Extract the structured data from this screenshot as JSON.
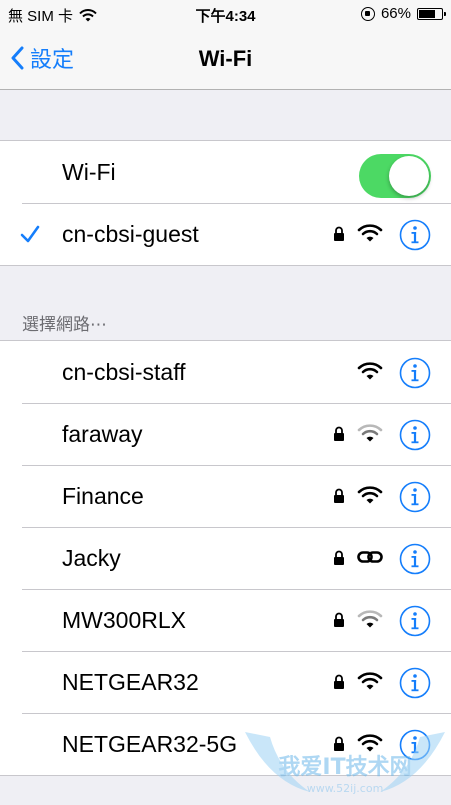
{
  "status_bar": {
    "carrier": "無 SIM 卡",
    "time": "下午4:34",
    "battery": "66%",
    "battery_level": 0.66
  },
  "nav": {
    "back_label": "設定",
    "title": "Wi-Fi"
  },
  "wifi_toggle": {
    "label": "Wi-Fi",
    "on": true,
    "color": "#4cd964"
  },
  "connected": {
    "name": "cn-cbsi-guest",
    "secured": true
  },
  "section_header": "選擇網路⋯",
  "networks": [
    {
      "name": "cn-cbsi-staff",
      "secured": false,
      "icon": "wifi-icon"
    },
    {
      "name": "faraway",
      "secured": true,
      "icon": "wifi-icon-weak"
    },
    {
      "name": "Finance",
      "secured": true,
      "icon": "wifi-icon"
    },
    {
      "name": "Jacky",
      "secured": true,
      "icon": "link-icon"
    },
    {
      "name": "MW300RLX",
      "secured": true,
      "icon": "wifi-icon-weak"
    },
    {
      "name": "NETGEAR32",
      "secured": true,
      "icon": "wifi-icon"
    },
    {
      "name": "NETGEAR32-5G",
      "secured": true,
      "icon": "wifi-icon"
    }
  ],
  "colors": {
    "accent": "#157efb",
    "background": "#efeff4"
  },
  "watermark": {
    "text": "我爱IT技术网",
    "url": "www.52ij.com"
  }
}
